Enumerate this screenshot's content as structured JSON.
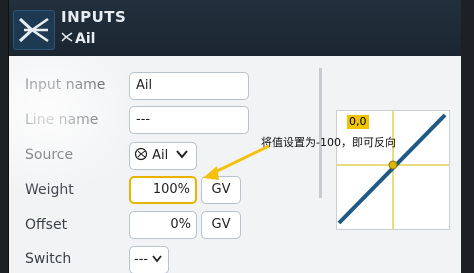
{
  "header": {
    "title": "INPUTS",
    "subtitle": "Ail"
  },
  "form": {
    "input_name": {
      "label": "Input name",
      "value": "Ail"
    },
    "line_name": {
      "label": "Line name",
      "value": "---"
    },
    "source": {
      "label": "Source",
      "value": "Ail"
    },
    "weight": {
      "label": "Weight",
      "value": "100%",
      "gv": "GV"
    },
    "offset": {
      "label": "Offset",
      "value": "0%",
      "gv": "GV"
    },
    "switch": {
      "label": "Switch",
      "value": "---"
    }
  },
  "curve": {
    "title": "0,0"
  },
  "annotation": {
    "note": "将值设置为-100，即可反向",
    "color": "#f4c20d"
  },
  "colors": {
    "accent": "#e5b500",
    "curve_line": "#1f5a86",
    "header": "#22303d"
  }
}
